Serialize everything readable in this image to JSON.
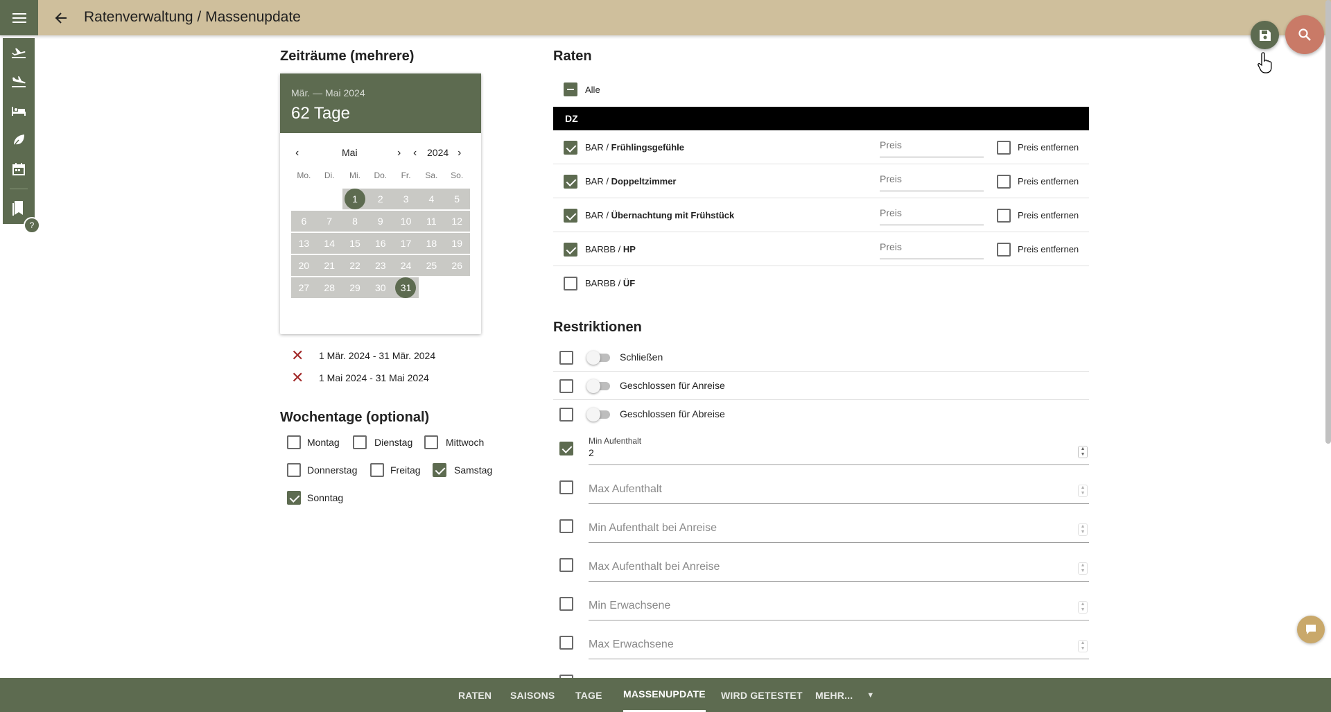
{
  "header": {
    "title": "Ratenverwaltung / Massenupdate"
  },
  "periods": {
    "heading": "Zeiträume (mehrere)",
    "calendar": {
      "range_label": "Mär. — Mai 2024",
      "days_label": "62 Tage",
      "month": "Mai",
      "year": "2024",
      "weekdays": [
        "Mo.",
        "Di.",
        "Mi.",
        "Do.",
        "Fr.",
        "Sa.",
        "So."
      ],
      "days": [
        "1",
        "2",
        "3",
        "4",
        "5",
        "6",
        "7",
        "8",
        "9",
        "10",
        "11",
        "12",
        "13",
        "14",
        "15",
        "16",
        "17",
        "18",
        "19",
        "20",
        "21",
        "22",
        "23",
        "24",
        "25",
        "26",
        "27",
        "28",
        "29",
        "30",
        "31"
      ]
    },
    "selected": [
      "1 Mär. 2024 - 31 Mär. 2024",
      "1 Mai 2024 - 31 Mai 2024"
    ]
  },
  "weekdays_section": {
    "heading": "Wochentage (optional)",
    "items": [
      {
        "label": "Montag",
        "checked": false
      },
      {
        "label": "Dienstag",
        "checked": false
      },
      {
        "label": "Mittwoch",
        "checked": false
      },
      {
        "label": "Donnerstag",
        "checked": false
      },
      {
        "label": "Freitag",
        "checked": false
      },
      {
        "label": "Samstag",
        "checked": true
      },
      {
        "label": "Sonntag",
        "checked": true
      }
    ]
  },
  "rates": {
    "heading": "Raten",
    "all_label": "Alle",
    "group": "DZ",
    "price_placeholder": "Preis",
    "remove_label": "Preis entfernen",
    "items": [
      {
        "prefix": "BAR / ",
        "name": "Frühlingsgefühle",
        "checked": true
      },
      {
        "prefix": "BAR / ",
        "name": "Doppeltzimmer",
        "checked": true
      },
      {
        "prefix": "BAR / ",
        "name": "Übernachtung mit Frühstück",
        "checked": true
      },
      {
        "prefix": "BARBB / ",
        "name": "HP",
        "checked": true
      },
      {
        "prefix": "BARBB / ",
        "name": "ÜF",
        "checked": false
      }
    ]
  },
  "restrictions": {
    "heading": "Restriktionen",
    "toggles": [
      "Schließen",
      "Geschlossen für Anreise",
      "Geschlossen für Abreise"
    ],
    "min_stay": {
      "label": "Min Aufenthalt",
      "value": "2"
    },
    "fields": [
      "Max Aufenthalt",
      "Min Aufenthalt bei Anreise",
      "Max Aufenthalt bei Anreise",
      "Min Erwachsene",
      "Max Erwachsene"
    ]
  },
  "bottom_nav": {
    "tabs": [
      "RATEN",
      "SAISONS",
      "TAGE",
      "MASSENUPDATE",
      "WIRD GETESTET",
      "MEHR..."
    ],
    "active": "MASSENUPDATE"
  },
  "help_badge": "?",
  "colors": {
    "primary": "#5d6b50",
    "topbar": "#cfbf9c",
    "accent": "#c97a67"
  }
}
